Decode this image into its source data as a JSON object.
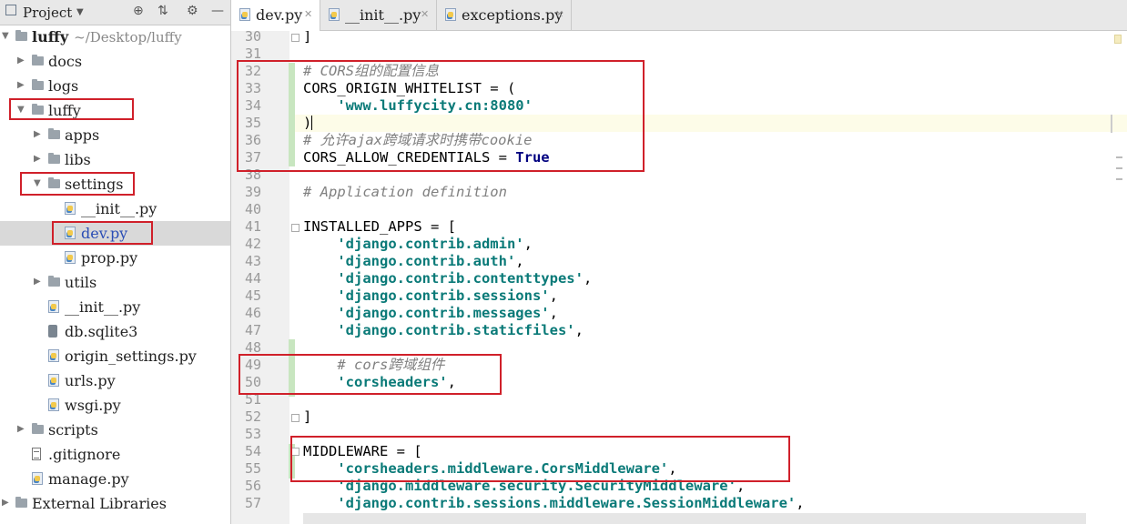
{
  "project_panel": {
    "title": "Project",
    "tree": [
      {
        "label": "luffy",
        "sub": "~/Desktop/luffy",
        "type": "folder",
        "level": 0,
        "expanded": true,
        "bold": true
      },
      {
        "label": "docs",
        "type": "folder",
        "level": 1,
        "expanded": false
      },
      {
        "label": "logs",
        "type": "folder",
        "level": 1,
        "expanded": false
      },
      {
        "label": "luffy",
        "type": "folder",
        "level": 1,
        "expanded": true,
        "highlighted": true
      },
      {
        "label": "apps",
        "type": "folder",
        "level": 2,
        "expanded": false
      },
      {
        "label": "libs",
        "type": "folder",
        "level": 2,
        "expanded": false
      },
      {
        "label": "settings",
        "type": "folder",
        "level": 2,
        "expanded": true,
        "highlighted": true
      },
      {
        "label": "__init__.py",
        "type": "py",
        "level": 3
      },
      {
        "label": "dev.py",
        "type": "py",
        "level": 3,
        "selected": true,
        "highlighted": true
      },
      {
        "label": "prop.py",
        "type": "py",
        "level": 3
      },
      {
        "label": "utils",
        "type": "folder",
        "level": 2,
        "expanded": false
      },
      {
        "label": "__init__.py",
        "type": "py",
        "level": 2
      },
      {
        "label": "db.sqlite3",
        "type": "db",
        "level": 2
      },
      {
        "label": "origin_settings.py",
        "type": "py",
        "level": 2
      },
      {
        "label": "urls.py",
        "type": "py",
        "level": 2
      },
      {
        "label": "wsgi.py",
        "type": "py",
        "level": 2
      },
      {
        "label": "scripts",
        "type": "folder",
        "level": 1,
        "expanded": false
      },
      {
        "label": ".gitignore",
        "type": "txt",
        "level": 1
      },
      {
        "label": "manage.py",
        "type": "py",
        "level": 1
      },
      {
        "label": "External Libraries",
        "type": "lib",
        "level": 0,
        "expanded": false
      }
    ]
  },
  "tabs": [
    {
      "label": "dev.py",
      "active": true
    },
    {
      "label": "__init__.py",
      "active": false
    },
    {
      "label": "exceptions.py",
      "active": false
    }
  ],
  "editor": {
    "current_line": 35,
    "lines": [
      {
        "n": "30",
        "tokens": [
          {
            "t": "]",
            "c": "p"
          }
        ]
      },
      {
        "n": "31",
        "tokens": []
      },
      {
        "n": "32",
        "tokens": [
          {
            "t": "# CORS组的配置信息",
            "c": "cm"
          }
        ]
      },
      {
        "n": "33",
        "tokens": [
          {
            "t": "CORS_ORIGIN_WHITELIST = (",
            "c": "p"
          }
        ]
      },
      {
        "n": "34",
        "tokens": [
          {
            "t": "    ",
            "c": "p"
          },
          {
            "t": "'www.luffycity.cn:8080'",
            "c": "str"
          }
        ]
      },
      {
        "n": "35",
        "tokens": [
          {
            "t": ")",
            "c": "p"
          }
        ]
      },
      {
        "n": "36",
        "tokens": [
          {
            "t": "# 允许ajax跨域请求时携带cookie",
            "c": "cm"
          }
        ]
      },
      {
        "n": "37",
        "tokens": [
          {
            "t": "CORS_ALLOW_CREDENTIALS = ",
            "c": "p"
          },
          {
            "t": "True",
            "c": "kw"
          }
        ]
      },
      {
        "n": "38",
        "tokens": []
      },
      {
        "n": "39",
        "tokens": [
          {
            "t": "# Application definition",
            "c": "cm"
          }
        ]
      },
      {
        "n": "40",
        "tokens": []
      },
      {
        "n": "41",
        "tokens": [
          {
            "t": "INSTALLED_APPS = [",
            "c": "p"
          }
        ]
      },
      {
        "n": "42",
        "tokens": [
          {
            "t": "    ",
            "c": "p"
          },
          {
            "t": "'django.contrib.admin'",
            "c": "str"
          },
          {
            "t": ",",
            "c": "p"
          }
        ]
      },
      {
        "n": "43",
        "tokens": [
          {
            "t": "    ",
            "c": "p"
          },
          {
            "t": "'django.contrib.auth'",
            "c": "str"
          },
          {
            "t": ",",
            "c": "p"
          }
        ]
      },
      {
        "n": "44",
        "tokens": [
          {
            "t": "    ",
            "c": "p"
          },
          {
            "t": "'django.contrib.contenttypes'",
            "c": "str"
          },
          {
            "t": ",",
            "c": "p"
          }
        ]
      },
      {
        "n": "45",
        "tokens": [
          {
            "t": "    ",
            "c": "p"
          },
          {
            "t": "'django.contrib.sessions'",
            "c": "str"
          },
          {
            "t": ",",
            "c": "p"
          }
        ]
      },
      {
        "n": "46",
        "tokens": [
          {
            "t": "    ",
            "c": "p"
          },
          {
            "t": "'django.contrib.messages'",
            "c": "str"
          },
          {
            "t": ",",
            "c": "p"
          }
        ]
      },
      {
        "n": "47",
        "tokens": [
          {
            "t": "    ",
            "c": "p"
          },
          {
            "t": "'django.contrib.staticfiles'",
            "c": "str"
          },
          {
            "t": ",",
            "c": "p"
          }
        ]
      },
      {
        "n": "48",
        "tokens": []
      },
      {
        "n": "49",
        "tokens": [
          {
            "t": "    ",
            "c": "p"
          },
          {
            "t": "# cors跨域组件",
            "c": "cm"
          }
        ]
      },
      {
        "n": "50",
        "tokens": [
          {
            "t": "    ",
            "c": "p"
          },
          {
            "t": "'corsheaders'",
            "c": "str"
          },
          {
            "t": ",",
            "c": "p"
          }
        ]
      },
      {
        "n": "51",
        "tokens": []
      },
      {
        "n": "52",
        "tokens": [
          {
            "t": "]",
            "c": "p"
          }
        ]
      },
      {
        "n": "53",
        "tokens": []
      },
      {
        "n": "54",
        "tokens": [
          {
            "t": "MIDDLEWARE = [",
            "c": "p"
          }
        ]
      },
      {
        "n": "55",
        "tokens": [
          {
            "t": "    ",
            "c": "p"
          },
          {
            "t": "'corsheaders.middleware.CorsMiddleware'",
            "c": "str"
          },
          {
            "t": ",",
            "c": "p"
          }
        ]
      },
      {
        "n": "56",
        "tokens": [
          {
            "t": "    ",
            "c": "p"
          },
          {
            "t": "'django.middleware.security.SecurityMiddleware'",
            "c": "str"
          },
          {
            "t": ",",
            "c": "p"
          }
        ]
      },
      {
        "n": "57",
        "tokens": [
          {
            "t": "    ",
            "c": "p"
          },
          {
            "t": "'django.contrib.sessions.middleware.SessionMiddleware'",
            "c": "str"
          },
          {
            "t": ",",
            "c": "p"
          }
        ]
      }
    ]
  },
  "colors": {
    "annotation_box": "#d0202a",
    "string": "#0a7a78",
    "keyword": "#000080",
    "comment": "#808080"
  }
}
